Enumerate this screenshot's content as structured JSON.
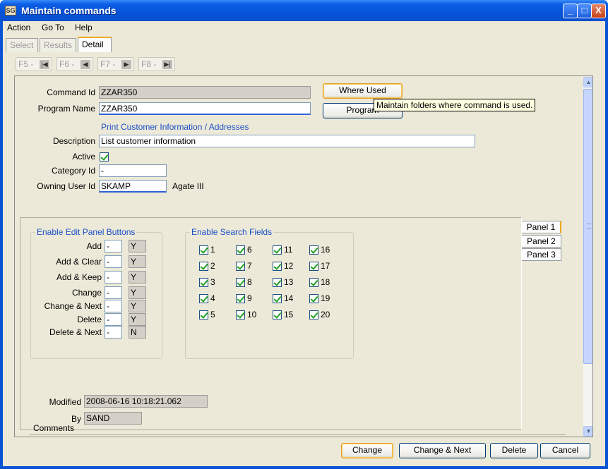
{
  "window": {
    "title": "Maintain commands",
    "icon": "app-icon"
  },
  "titlebar_buttons": {
    "minimize": "_",
    "maximize": "□",
    "close": "X"
  },
  "menu": {
    "action": "Action",
    "goto": "Go To",
    "help": "Help"
  },
  "tabs": {
    "select": "Select",
    "results": "Results",
    "detail": "Detail"
  },
  "nav": {
    "f5": "F5 -",
    "f6": "F6 -",
    "f7": "F7 -",
    "f8": "F8 -"
  },
  "form": {
    "command_id_label": "Command Id",
    "command_id_value": "ZZAR350",
    "program_name_label": "Program Name",
    "program_name_value": "ZZAR350",
    "program_title": "Print Customer Information / Addresses",
    "description_label": "Description",
    "description_value": "List customer information",
    "active_label": "Active",
    "active_checked": true,
    "category_label": "Category Id",
    "category_value": "-",
    "owning_user_label": "Owning User Id",
    "owning_user_value": "SKAMP",
    "owning_user_name": "Agate III"
  },
  "buttons": {
    "where_used": "Where Used",
    "program": "Program"
  },
  "tooltip": "Maintain folders where command is used.",
  "edit_panel": {
    "title": "Enable Edit Panel Buttons",
    "rows": [
      {
        "label": "Add",
        "value": "-",
        "flag": "Y"
      },
      {
        "label": "Add & Clear",
        "value": "-",
        "flag": "Y"
      },
      {
        "label": "Add & Keep",
        "value": "-",
        "flag": "Y"
      },
      {
        "label": "Change",
        "value": "-",
        "flag": "Y"
      },
      {
        "label": "Change & Next",
        "value": "-",
        "flag": "Y"
      },
      {
        "label": "Delete",
        "value": "-",
        "flag": "Y"
      },
      {
        "label": "Delete & Next",
        "value": "-",
        "flag": "N"
      }
    ]
  },
  "search_fields": {
    "title": "Enable Search Fields",
    "labels": [
      "1",
      "2",
      "3",
      "4",
      "5",
      "6",
      "7",
      "8",
      "9",
      "10",
      "11",
      "12",
      "13",
      "14",
      "15",
      "16",
      "17",
      "18",
      "19",
      "20"
    ]
  },
  "side_tabs": {
    "p1": "Panel 1",
    "p2": "Panel 2",
    "p3": "Panel 3"
  },
  "modified": {
    "label": "Modified",
    "value": "2008-06-16 10:18:21.062",
    "by_label": "By",
    "by_value": "SAND"
  },
  "comments_label": "Comments",
  "bottom_buttons": {
    "change": "Change",
    "change_next": "Change & Next",
    "delete": "Delete",
    "cancel": "Cancel"
  }
}
